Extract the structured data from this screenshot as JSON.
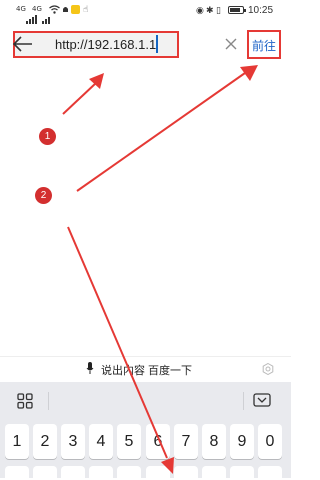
{
  "status": {
    "signal1": "4G",
    "signal2": "4G",
    "time": "10:25"
  },
  "browser": {
    "url": "http://192.168.1.1",
    "go_label": "前往",
    "clear_symbol": "×"
  },
  "annotations": {
    "badge1": "1",
    "badge2": "2",
    "color": "#e53935"
  },
  "voice": {
    "prompt": "说出内容 百度一下"
  },
  "keyboard": {
    "digits": [
      "1",
      "2",
      "3",
      "4",
      "5",
      "6",
      "7",
      "8",
      "9",
      "0"
    ]
  }
}
